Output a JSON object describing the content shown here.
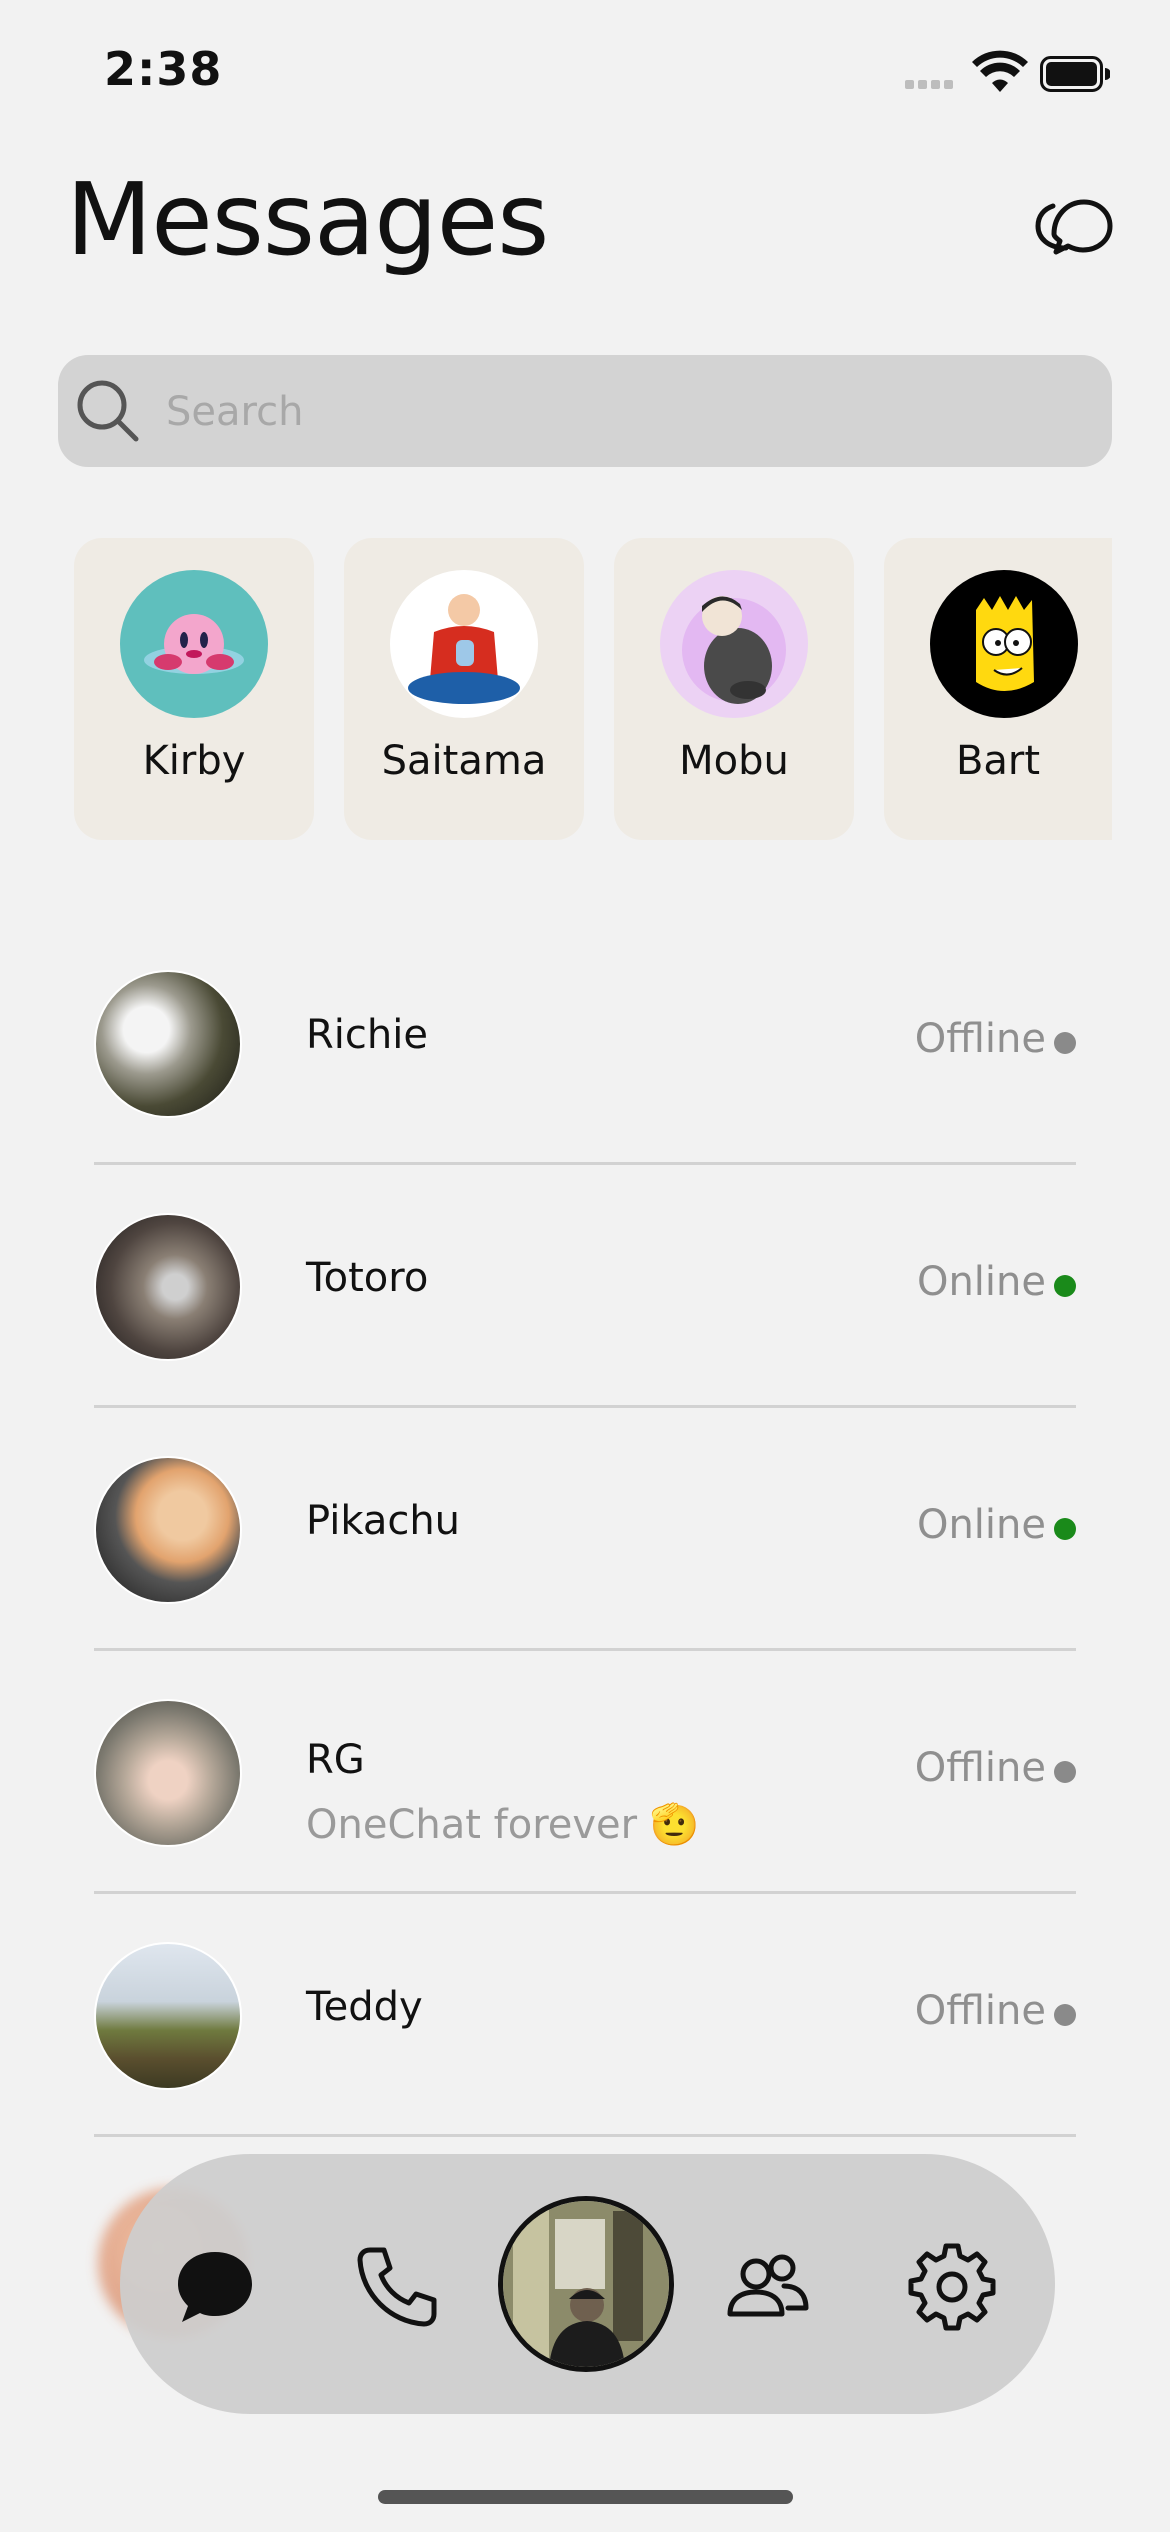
{
  "status_bar": {
    "time": "2:38"
  },
  "header": {
    "title": "Messages",
    "compose_icon": "chat-bubbles-icon"
  },
  "search": {
    "placeholder": "Search",
    "icon": "search-icon"
  },
  "stories": [
    {
      "name": "Kirby"
    },
    {
      "name": "Saitama"
    },
    {
      "name": "Mobu"
    },
    {
      "name": "Bart"
    }
  ],
  "conversations": [
    {
      "name": "Richie",
      "preview": "",
      "status": "Offline",
      "status_color": "#8a8a8a"
    },
    {
      "name": "Totoro",
      "preview": "",
      "status": "Online",
      "status_color": "#1a8a1a"
    },
    {
      "name": "Pikachu",
      "preview": "",
      "status": "Online",
      "status_color": "#1a8a1a"
    },
    {
      "name": "RG",
      "preview": "OneChat forever 🫡",
      "status": "Offline",
      "status_color": "#8a8a8a"
    },
    {
      "name": "Teddy",
      "preview": "",
      "status": "Offline",
      "status_color": "#8a8a8a"
    }
  ],
  "tab_bar": {
    "tabs": [
      "chat-icon",
      "phone-icon",
      "profile-avatar",
      "people-icon",
      "gear-icon"
    ]
  }
}
